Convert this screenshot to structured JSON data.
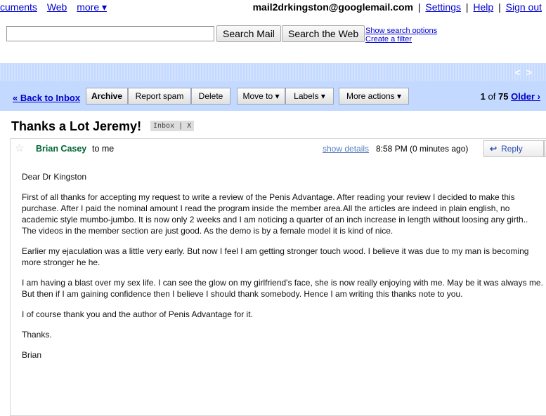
{
  "topnav": {
    "documents": "cuments",
    "web": "Web",
    "more": "more ▾",
    "email": "mail2drkingston@googlemail.com",
    "settings": "Settings",
    "help": "Help",
    "signout": "Sign out",
    "separator": "|"
  },
  "search": {
    "search_mail": "Search Mail",
    "search_web": "Search the Web",
    "show_options": "Show search options",
    "create_filter": "Create a filter"
  },
  "strip": {
    "prev": "<",
    "next": ">"
  },
  "toolbar": {
    "back": "« Back to Inbox",
    "archive": "Archive",
    "report_spam": "Report spam",
    "delete": "Delete",
    "move_to": "Move to ▾",
    "labels": "Labels ▾",
    "more_actions": "More actions ▾",
    "page_current": "1",
    "page_of": "of",
    "page_total": "75",
    "older": "Older ›"
  },
  "subject": {
    "title": "Thanks a Lot Jeremy!",
    "label": "Inbox | X"
  },
  "message": {
    "star": "☆",
    "sender": "Brian Casey",
    "to": "to me",
    "show_details": "show details",
    "time": "8:58 PM (0 minutes ago)",
    "reply_arrow": "↩",
    "reply": "Reply",
    "reply_more": "▾",
    "paragraphs": [
      "Dear Dr Kingston",
      "First of all thanks for accepting my request to write a review of the Penis Advantage. After reading your review I decided to make this purchase. After I paid the nominal amount I read the program inside the member area.All the articles are indeed in plain english, no academic style mumbo-jumbo. It is now only 2 weeks and I am noticing a quarter of an inch increase in length without loosing any girth.. The videos in the member section are just good. As the demo is by a female model it is kind of nice.",
      "Earlier my ejaculation was a little very early. But now I feel I am getting stronger touch wood. I believe it was due to my man is becoming more stronger he he.",
      "I am having a blast over my sex life. I can see the glow on my girlfriend's face, she is now really enjoying with me. May be it was always me. But then if I am gaining confidence then I believe I should thank somebody. Hence I am writing this thanks note to you.",
      "I of course thank you and the author of Penis Advantage for it.",
      "Thanks.",
      "Brian"
    ]
  }
}
